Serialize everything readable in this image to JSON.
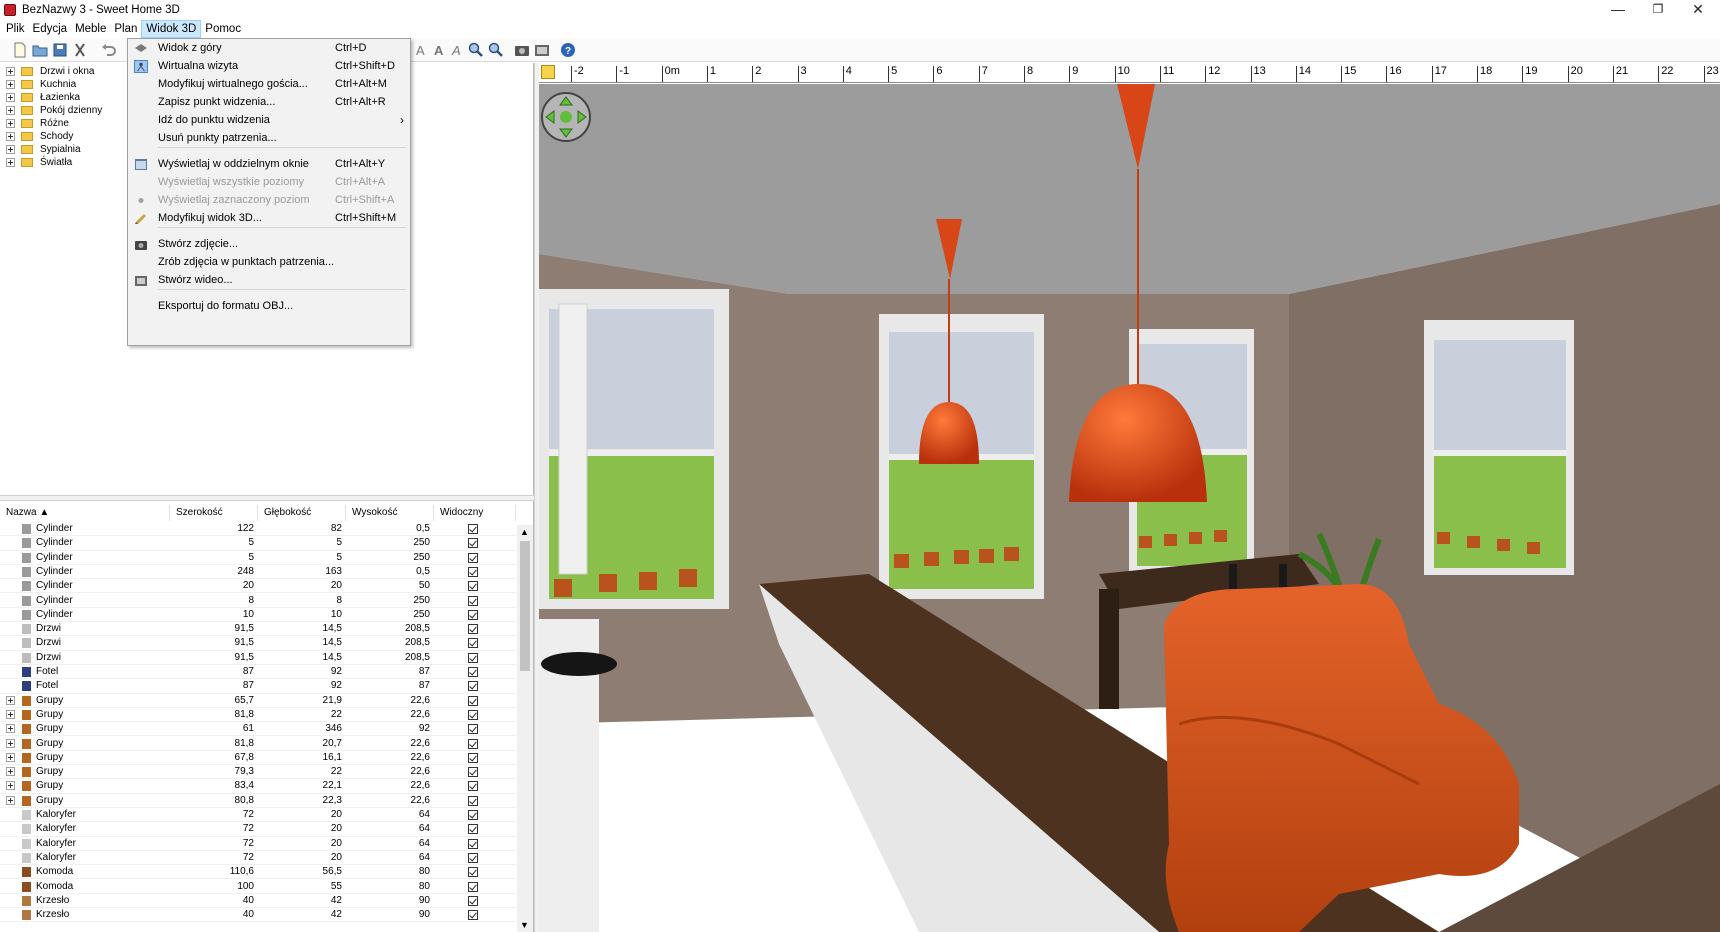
{
  "window": {
    "title": "BezNazwy 3 - Sweet Home 3D"
  },
  "menubar": [
    {
      "label": "Plik"
    },
    {
      "label": "Edycja"
    },
    {
      "label": "Meble"
    },
    {
      "label": "Plan"
    },
    {
      "label": "Widok 3D",
      "active": true
    },
    {
      "label": "Pomoc"
    }
  ],
  "catalog": {
    "categories": [
      "Drzwi i okna",
      "Kuchnia",
      "Łazienka",
      "Pokój dzienny",
      "Różne",
      "Schody",
      "Sypialnia",
      "Światła"
    ]
  },
  "furniture": {
    "columns": [
      "Nazwa ▲",
      "Szerokość",
      "Głębokość",
      "Wysokość",
      "Widoczny"
    ],
    "rows": [
      {
        "name": "Cylinder",
        "w": "122",
        "d": "82",
        "h": "0,5",
        "icon": "cylinder-icon",
        "expandable": false
      },
      {
        "name": "Cylinder",
        "w": "5",
        "d": "5",
        "h": "250",
        "icon": "cylinder-icon",
        "expandable": false
      },
      {
        "name": "Cylinder",
        "w": "5",
        "d": "5",
        "h": "250",
        "icon": "cylinder-icon",
        "expandable": false
      },
      {
        "name": "Cylinder",
        "w": "248",
        "d": "163",
        "h": "0,5",
        "icon": "cylinder-icon",
        "expandable": false
      },
      {
        "name": "Cylinder",
        "w": "20",
        "d": "20",
        "h": "50",
        "icon": "cylinder-icon",
        "expandable": false
      },
      {
        "name": "Cylinder",
        "w": "8",
        "d": "8",
        "h": "250",
        "icon": "cylinder-icon",
        "expandable": false
      },
      {
        "name": "Cylinder",
        "w": "10",
        "d": "10",
        "h": "250",
        "icon": "cylinder-icon",
        "expandable": false
      },
      {
        "name": "Drzwi",
        "w": "91,5",
        "d": "14,5",
        "h": "208,5",
        "icon": "door-icon",
        "expandable": false
      },
      {
        "name": "Drzwi",
        "w": "91,5",
        "d": "14,5",
        "h": "208,5",
        "icon": "door-icon",
        "expandable": false
      },
      {
        "name": "Drzwi",
        "w": "91,5",
        "d": "14,5",
        "h": "208,5",
        "icon": "door-icon",
        "expandable": false
      },
      {
        "name": "Fotel",
        "w": "87",
        "d": "92",
        "h": "87",
        "icon": "armchair-icon",
        "expandable": false
      },
      {
        "name": "Fotel",
        "w": "87",
        "d": "92",
        "h": "87",
        "icon": "armchair-icon",
        "expandable": false
      },
      {
        "name": "Grupy",
        "w": "65,7",
        "d": "21,9",
        "h": "22,6",
        "icon": "group-icon",
        "expandable": true
      },
      {
        "name": "Grupy",
        "w": "81,8",
        "d": "22",
        "h": "22,6",
        "icon": "group-icon",
        "expandable": true
      },
      {
        "name": "Grupy",
        "w": "61",
        "d": "346",
        "h": "92",
        "icon": "group-icon",
        "expandable": true
      },
      {
        "name": "Grupy",
        "w": "81,8",
        "d": "20,7",
        "h": "22,6",
        "icon": "group-icon",
        "expandable": true
      },
      {
        "name": "Grupy",
        "w": "67,8",
        "d": "16,1",
        "h": "22,6",
        "icon": "group-icon",
        "expandable": true
      },
      {
        "name": "Grupy",
        "w": "79,3",
        "d": "22",
        "h": "22,6",
        "icon": "group-icon",
        "expandable": true
      },
      {
        "name": "Grupy",
        "w": "83,4",
        "d": "22,1",
        "h": "22,6",
        "icon": "group-icon",
        "expandable": true
      },
      {
        "name": "Grupy",
        "w": "80,8",
        "d": "22,3",
        "h": "22,6",
        "icon": "group-icon",
        "expandable": true
      },
      {
        "name": "Kaloryfer",
        "w": "72",
        "d": "20",
        "h": "64",
        "icon": "radiator-icon",
        "expandable": false
      },
      {
        "name": "Kaloryfer",
        "w": "72",
        "d": "20",
        "h": "64",
        "icon": "radiator-icon",
        "expandable": false
      },
      {
        "name": "Kaloryfer",
        "w": "72",
        "d": "20",
        "h": "64",
        "icon": "radiator-icon",
        "expandable": false
      },
      {
        "name": "Kaloryfer",
        "w": "72",
        "d": "20",
        "h": "64",
        "icon": "radiator-icon",
        "expandable": false
      },
      {
        "name": "Komoda",
        "w": "110,6",
        "d": "56,5",
        "h": "80",
        "icon": "dresser-icon",
        "expandable": false
      },
      {
        "name": "Komoda",
        "w": "100",
        "d": "55",
        "h": "80",
        "icon": "dresser-icon",
        "expandable": false
      },
      {
        "name": "Krzesło",
        "w": "40",
        "d": "42",
        "h": "90",
        "icon": "chair-icon",
        "expandable": false
      },
      {
        "name": "Krzesło",
        "w": "40",
        "d": "42",
        "h": "90",
        "icon": "chair-icon",
        "expandable": false
      }
    ]
  },
  "ruler": {
    "labels": [
      "-2",
      "-1",
      "0m",
      "1",
      "2",
      "3",
      "4",
      "5",
      "6",
      "7",
      "8",
      "9",
      "10",
      "11",
      "12",
      "13",
      "14",
      "15",
      "16",
      "17",
      "18",
      "19",
      "20",
      "21",
      "22",
      "23"
    ]
  },
  "dropdown": {
    "items": [
      {
        "label": "Widok z góry",
        "shortcut": "Ctrl+D",
        "icon": "top-view-icon",
        "disabled": false
      },
      {
        "label": "Wirtualna wizyta",
        "shortcut": "Ctrl+Shift+D",
        "icon": "virtual-visit-icon",
        "disabled": false,
        "checked": true
      },
      {
        "label": "Modyfikuj wirtualnego gościa...",
        "shortcut": "Ctrl+Alt+M",
        "disabled": false
      },
      {
        "label": "Zapisz punkt widzenia...",
        "shortcut": "Ctrl+Alt+R",
        "disabled": false
      },
      {
        "label": "Idź do punktu widzenia",
        "shortcut": "",
        "submenu": true,
        "disabled": false
      },
      {
        "label": "Usuń punkty patrzenia...",
        "shortcut": "",
        "disabled": false
      },
      {
        "sep": true
      },
      {
        "label": "Wyświetlaj w oddzielnym oknie",
        "shortcut": "Ctrl+Alt+Y",
        "icon": "window-icon",
        "disabled": false
      },
      {
        "label": "Wyświetlaj wszystkie poziomy",
        "shortcut": "Ctrl+Alt+A",
        "disabled": true
      },
      {
        "label": "Wyświetlaj zaznaczony poziom",
        "shortcut": "Ctrl+Shift+A",
        "icon": "radio-dot-icon",
        "disabled": true
      },
      {
        "label": "Modyfikuj widok 3D...",
        "shortcut": "Ctrl+Shift+M",
        "icon": "modify-3d-icon",
        "disabled": false
      },
      {
        "sep": true
      },
      {
        "label": "Stwórz zdjęcie...",
        "shortcut": "",
        "icon": "camera-icon",
        "disabled": false
      },
      {
        "label": "Zrób zdjęcia w punktach patrzenia...",
        "shortcut": "",
        "disabled": false
      },
      {
        "label": "Stwórz wideo...",
        "shortcut": "",
        "icon": "video-icon",
        "disabled": false
      },
      {
        "sep": true
      },
      {
        "label": "Eksportuj do formatu OBJ...",
        "shortcut": "",
        "disabled": false
      }
    ]
  },
  "colors": {
    "wall": "#8c7a6e",
    "ceiling": "#9e9e9e",
    "floor": "#6a5242",
    "lamp": "#e2471a",
    "sofa": "#d2541d",
    "counter": "#4e3220"
  }
}
